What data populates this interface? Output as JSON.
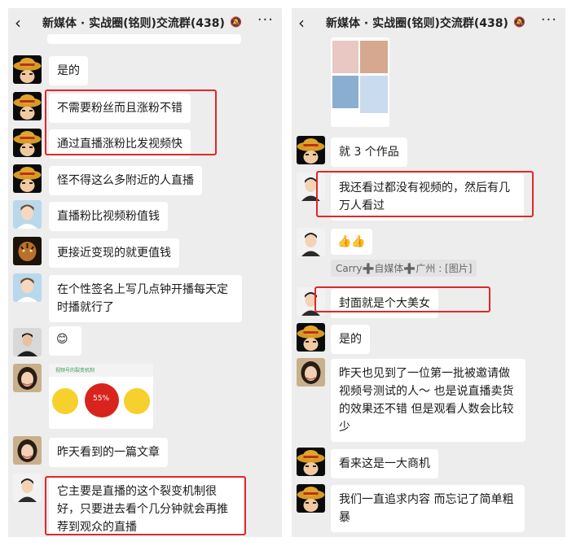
{
  "chat": {
    "title": "新媒体 · 实战圈(铭则)交流群(438)",
    "back_icon": "‹",
    "more_icon": "···",
    "mute_icon": "🔕"
  },
  "left": {
    "messages": [
      {
        "text": "是的"
      },
      {
        "text": "不需要粉丝而且涨粉不错"
      },
      {
        "text": "通过直播涨粉比发视频快"
      },
      {
        "text": "怪不得这么多附近的人直播"
      },
      {
        "text": "直播粉比视频粉值钱"
      },
      {
        "text": "更接近变现的就更值钱"
      },
      {
        "text": "在个性签名上写几点钟开播每天定时播就行了"
      },
      {
        "text": "😊"
      },
      {
        "text": "昨天看到的一篇文章"
      },
      {
        "text": "它主要是直播的这个裂变机制很好，只要进去看个几分钟就会再推荐到观众的直播"
      }
    ],
    "article_image": {
      "banner": "视频号的裂变机制",
      "percent": "55%"
    }
  },
  "right": {
    "messages": [
      {
        "text": "就 3 个作品"
      },
      {
        "text": "我还看过都没有视频的，然后有几万人看过"
      },
      {
        "text": "👍👍"
      },
      {
        "text": "封面就是个大美女"
      },
      {
        "text": "是的"
      },
      {
        "text": "昨天也见到了一位第一批被邀请做视频号测试的人～  也是说直播卖货的效果还不错  但是观看人数会比较少"
      },
      {
        "text": "看来这是一大商机"
      },
      {
        "text": "我们一直追求内容 而忘记了简单粗暴"
      }
    ],
    "quote": "Carry➕自媒体➕广州 : [图片]"
  },
  "colors": {
    "panel_bg": "#ededed",
    "bubble_bg": "#ffffff",
    "highlight": "#e0272a",
    "text": "#1a1a1a"
  }
}
